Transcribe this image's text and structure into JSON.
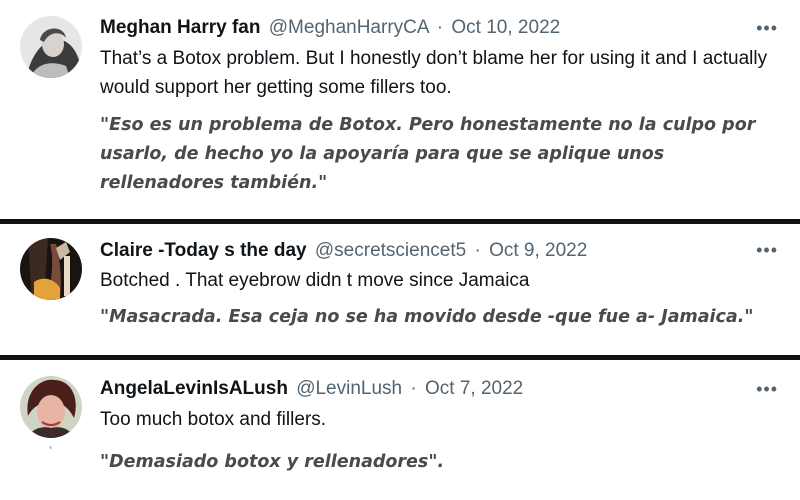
{
  "tweets": [
    {
      "display_name": "Meghan Harry fan",
      "handle": "@MeghanHarryCA",
      "date": "Oct 10, 2022",
      "text": "That’s a Botox problem. But I honestly don’t blame her for using it and I actually would support her getting some fillers too.",
      "translation": "\"Eso es un problema de Botox. Pero honestamente no la culpo por usarlo, de hecho yo la apoyaría para que se aplique unos rellenadores también.\"",
      "more_label": "•••"
    },
    {
      "display_name": "Claire -Today s the day",
      "handle": "@secretsciencet5",
      "date": "Oct 9, 2022",
      "text": "Botched . That eyebrow didn t move since Jamaica",
      "translation": "\"Masacrada. Esa ceja no se ha movido desde -que fue a- Jamaica.\"",
      "more_label": "•••"
    },
    {
      "display_name": "AngelaLevinIsALush",
      "handle": "@LevinLush",
      "date": "Oct 7, 2022",
      "text": "Too much botox and fillers.",
      "translation": "\"Demasiado botox y rellenadores\".",
      "more_label": "•••"
    }
  ],
  "separator": "·",
  "icons": {
    "more": "more-horizontal-icon"
  },
  "colors": {
    "name": "#0f1419",
    "meta": "#536471",
    "translation": "#4a4a4a",
    "divider": "#111111"
  }
}
